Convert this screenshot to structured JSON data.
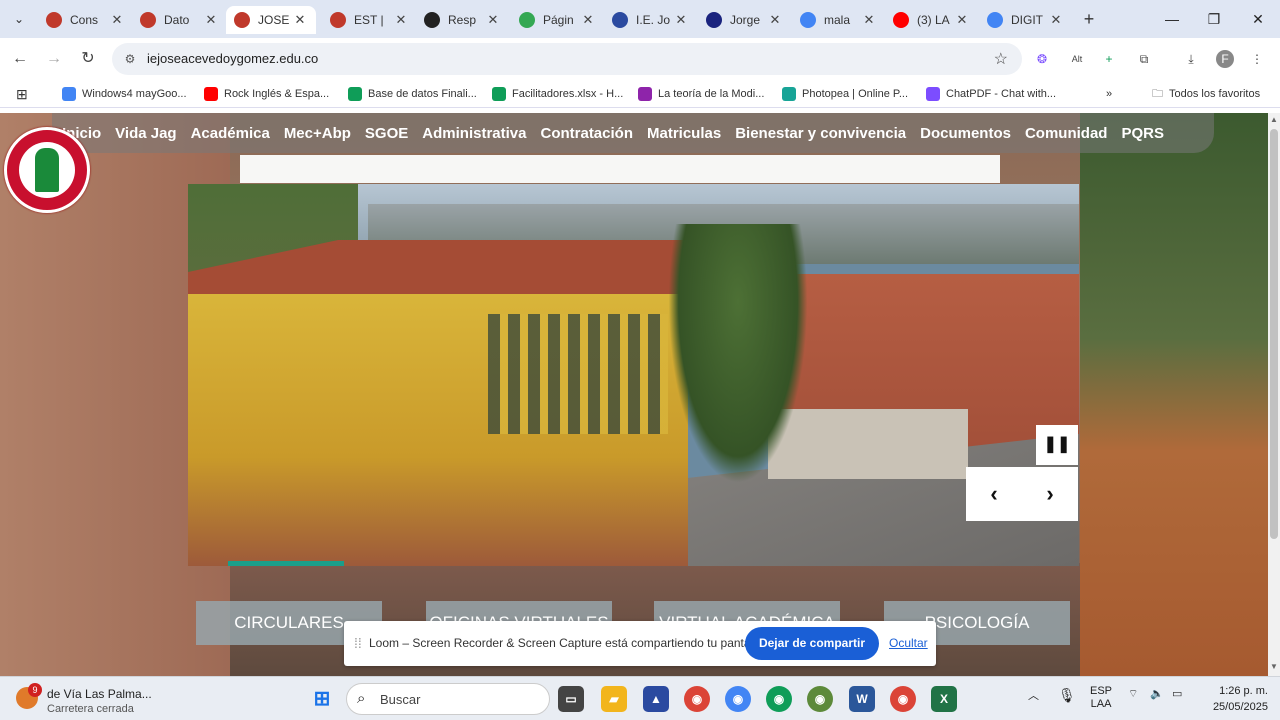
{
  "browser": {
    "tabs": [
      {
        "title": "Cons",
        "favicon_color": "#c0392b"
      },
      {
        "title": "Dato",
        "favicon_color": "#c0392b"
      },
      {
        "title": "JOSE",
        "favicon_color": "#c0392b",
        "active": true
      },
      {
        "title": "EST |",
        "favicon_color": "#c0392b"
      },
      {
        "title": "Resp",
        "favicon_color": "#222222"
      },
      {
        "title": "Págin",
        "favicon_color": "#34a853"
      },
      {
        "title": "I.E. Jo",
        "favicon_color": "#2b4aa0"
      },
      {
        "title": "Jorge",
        "favicon_color": "#1a237e"
      },
      {
        "title": "mala",
        "favicon_color": "#4285f4"
      },
      {
        "title": "(3) LA",
        "favicon_color": "#ff0000"
      },
      {
        "title": "DIGIT",
        "favicon_color": "#4285f4"
      }
    ],
    "url": "iejoseacevedoygomez.edu.co",
    "bookmarks": [
      {
        "label": "Windows4 mayGoo...",
        "color": "#4285f4"
      },
      {
        "label": "Rock Inglés & Espa...",
        "color": "#ff0000"
      },
      {
        "label": "Base de datos Finali...",
        "color": "#0f9d58"
      },
      {
        "label": "Facilitadores.xlsx - H...",
        "color": "#0f9d58"
      },
      {
        "label": "La teoría de la Modi...",
        "color": "#8e24aa"
      },
      {
        "label": "Photopea | Online P...",
        "color": "#18a497"
      },
      {
        "label": "ChatPDF - Chat with...",
        "color": "#7c4dff"
      }
    ],
    "all_bookmarks_label": "Todos los favoritos"
  },
  "site": {
    "nav": [
      "Inicio",
      "Vida Jag",
      "Académica",
      "Mec+Abp",
      "SGOE",
      "Administrativa",
      "Contratación",
      "Matriculas",
      "Bienestar y convivencia",
      "Documentos",
      "Comunidad",
      "PQRS"
    ],
    "categories": [
      "CIRCULARES",
      "OFICINAS VIRTUALES",
      "VIRTUAL ACADÉMICA",
      "PSICOLOGÍA"
    ],
    "slider_progress": 0.13
  },
  "loom": {
    "message": "Loom – Screen Recorder & Screen Capture está compartiendo tu pantalla.",
    "stop_label": "Dejar de compartir",
    "hide_label": "Ocultar"
  },
  "taskbar": {
    "weather_badge": "9",
    "weather_title": "de Vía Las Palma...",
    "weather_sub": "Carretera cerrada",
    "search_placeholder": "Buscar",
    "lang1": "ESP",
    "lang2": "LAA",
    "time": "1:26 p. m.",
    "date": "25/05/2025"
  }
}
